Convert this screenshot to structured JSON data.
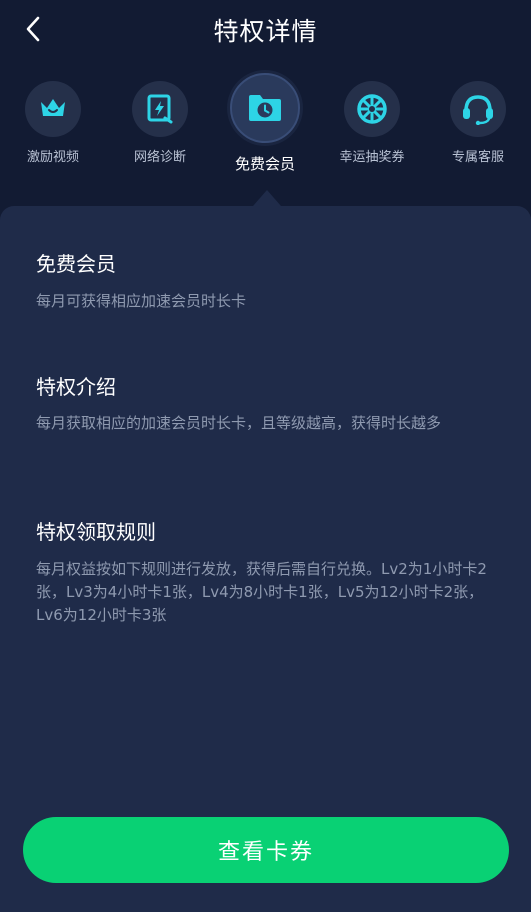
{
  "header": {
    "title": "特权详情",
    "back_icon": "chevron-left-icon"
  },
  "privileges": [
    {
      "label": "激励视频",
      "icon": "crown-icon",
      "active": false
    },
    {
      "label": "网络诊断",
      "icon": "network-diagnosis-icon",
      "active": false
    },
    {
      "label": "免费会员",
      "icon": "folder-clock-icon",
      "active": true
    },
    {
      "label": "幸运抽奖券",
      "icon": "lucky-wheel-icon",
      "active": false
    },
    {
      "label": "专属客服",
      "icon": "headset-icon",
      "active": false
    }
  ],
  "sections": [
    {
      "title": "免费会员",
      "text": "每月可获得相应加速会员时长卡"
    },
    {
      "title": "特权介绍",
      "text": "每月获取相应的加速会员时长卡，且等级越高，获得时长越多"
    },
    {
      "title": "特权领取规则",
      "text": "每月权益按如下规则进行发放，获得后需自行兑换。Lv2为1小时卡2张，Lv3为4小时卡1张，Lv4为8小时卡1张，Lv5为12小时卡2张，Lv6为12小时卡3张"
    }
  ],
  "cta": {
    "label": "查看卡券"
  },
  "colors": {
    "background": "#121b33",
    "panel": "#1f2b49",
    "accent": "#2dd4e6",
    "button": "#09d174"
  }
}
